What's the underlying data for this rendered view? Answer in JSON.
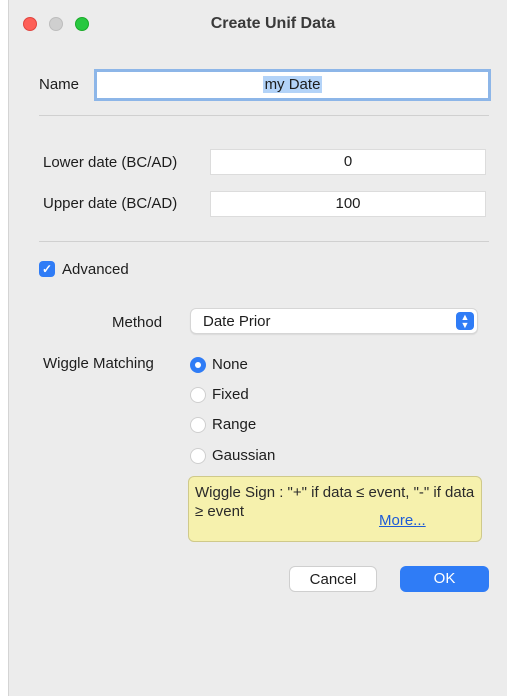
{
  "window": {
    "title": "Create Unif Data"
  },
  "form": {
    "name_label": "Name",
    "name_value": "my Date",
    "lower_label": "Lower date (BC/AD)",
    "lower_value": "0",
    "upper_label": "Upper date (BC/AD)",
    "upper_value": "100",
    "advanced_label": "Advanced",
    "advanced_checked": true,
    "method_label": "Method",
    "method_value": "Date Prior",
    "wiggle_label": "Wiggle Matching",
    "wiggle_options": [
      {
        "label": "None",
        "selected": true
      },
      {
        "label": "Fixed",
        "selected": false
      },
      {
        "label": "Range",
        "selected": false
      },
      {
        "label": "Gaussian",
        "selected": false
      }
    ],
    "note_text": "Wiggle Sign : \"+\" if data ≤ event, \"-\" if data ≥ event",
    "note_link": "More..."
  },
  "buttons": {
    "cancel": "Cancel",
    "ok": "OK"
  },
  "colors": {
    "accent": "#2f7cf6",
    "note_bg": "#f6f1ad",
    "window_bg": "#ececec"
  }
}
